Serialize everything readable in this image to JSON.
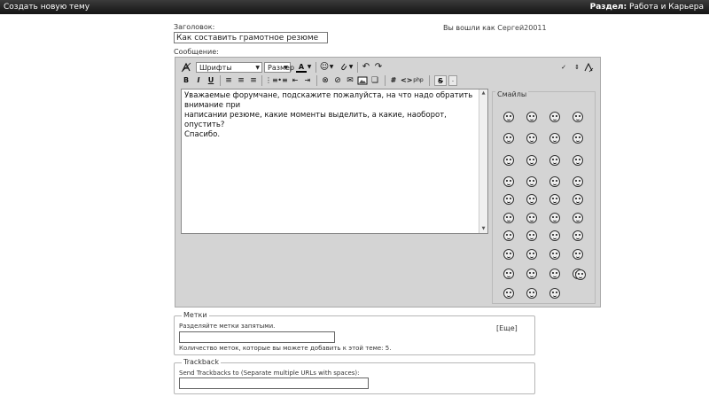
{
  "topbar": {
    "left_title": "Создать новую тему",
    "section_label": "Раздел:",
    "section_value": "Работа и Карьера"
  },
  "form": {
    "title_label": "Заголовок:",
    "title_value": "Как составить грамотное резюме",
    "message_label": "Сообщение:",
    "logged_in_prefix": "Вы вошли как",
    "username": "Сергей20011"
  },
  "editor": {
    "font_select": "Шрифты",
    "size_select": "Размер",
    "text_lines": [
      "Уважаемые форумчане, подскажите пожалуйста, на что надо обратить внимание при",
      "написании резюме, какие моменты выделить, а какие, наоборот, опустить?",
      "Спасибо."
    ],
    "icons": [
      "clear-format-icon",
      "text-color-icon",
      "smiley-menu-icon",
      "attachment-icon",
      "undo-icon",
      "redo-icon",
      "spellcheck-icon",
      "resize-icon",
      "bold-icon",
      "italic-icon",
      "underline-icon",
      "align-left-icon",
      "align-center-icon",
      "align-right-icon",
      "ordered-list-icon",
      "unordered-list-icon",
      "outdent-icon",
      "indent-icon",
      "link-icon",
      "unlink-icon",
      "email-link-icon",
      "image-icon",
      "quote-icon",
      "code-tag-icon",
      "html-tag-icon",
      "php-tag-icon",
      "strikethrough-icon"
    ]
  },
  "smilies": {
    "title": "Смайлы",
    "more_link": "[Еще]"
  },
  "tags": {
    "legend": "Метки",
    "hint": "Разделяйте метки запятыми.",
    "input_value": "",
    "count_note": "Количество меток, которые вы можете добавить к этой теме: 5."
  },
  "trackback": {
    "legend": "Trackback",
    "hint": "Send Trackbacks to (Separate multiple URLs with spaces):",
    "input_value": ""
  }
}
